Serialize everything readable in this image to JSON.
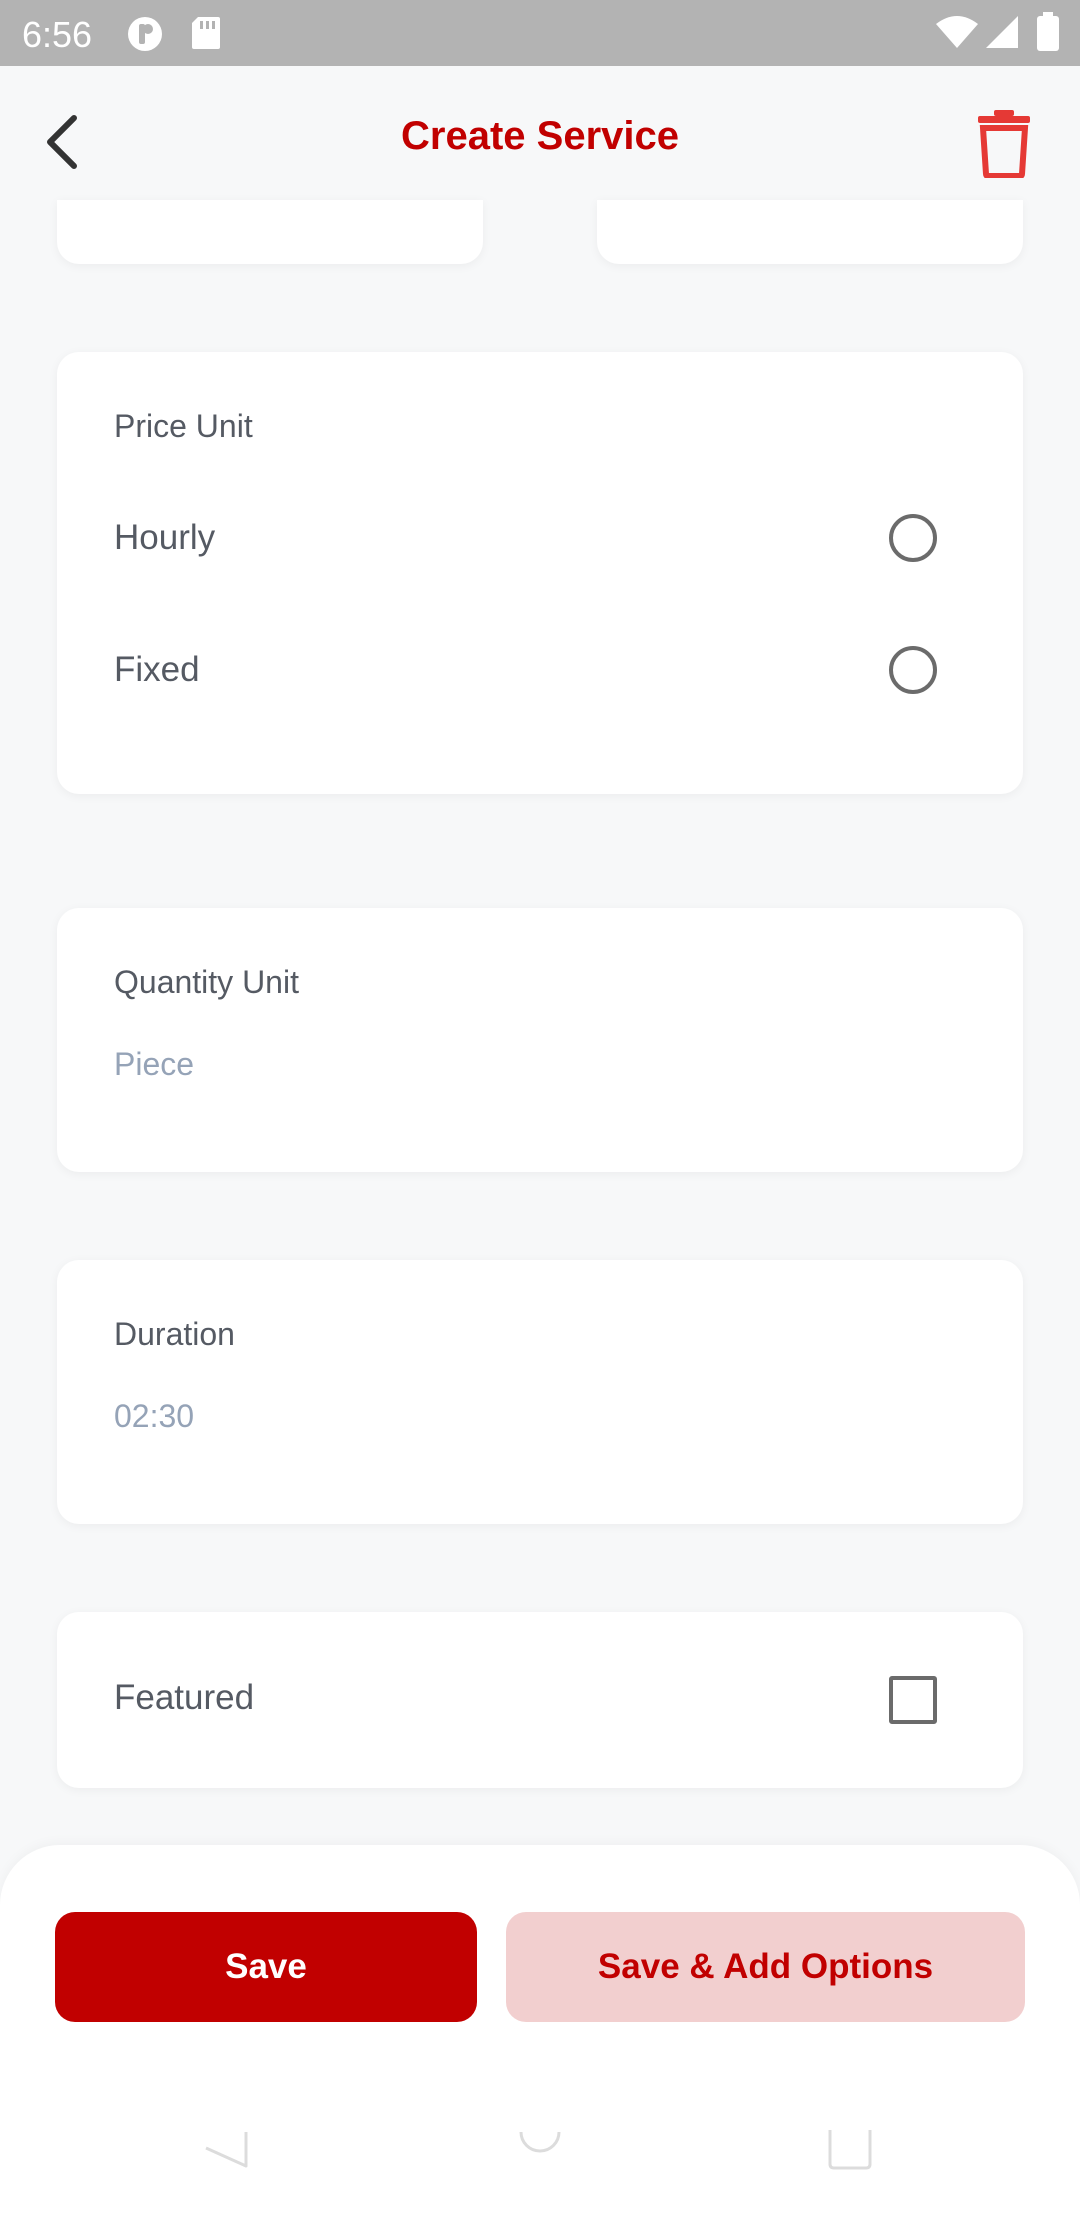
{
  "status_bar": {
    "time": "6:56",
    "icons": [
      "pocket-icon",
      "sd-card-icon",
      "wifi-icon",
      "signal-icon",
      "battery-icon"
    ]
  },
  "header": {
    "title": "Create Service",
    "back_icon": "back-arrow-icon",
    "delete_icon": "trash-icon"
  },
  "price_unit": {
    "label": "Price Unit",
    "options": [
      {
        "label": "Hourly",
        "selected": false
      },
      {
        "label": "Fixed",
        "selected": false
      }
    ]
  },
  "quantity_unit": {
    "label": "Quantity Unit",
    "placeholder": "Piece"
  },
  "duration": {
    "label": "Duration",
    "placeholder": "02:30"
  },
  "featured": {
    "label": "Featured",
    "checked": false
  },
  "actions": {
    "save_label": "Save",
    "save_add_options_label": "Save & Add Options"
  },
  "colors": {
    "accent": "#c10000",
    "accent_light": "#f2cfcf",
    "background": "#f7f8f9",
    "card": "#ffffff"
  }
}
